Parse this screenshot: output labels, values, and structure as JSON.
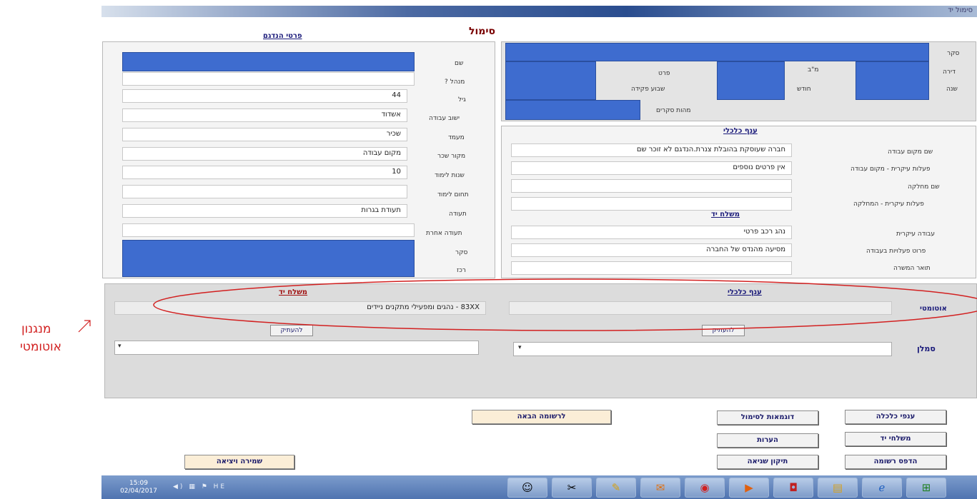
{
  "window": {
    "title": "סימול יד"
  },
  "page": {
    "title": "סימול"
  },
  "sample": {
    "header": "פרטי הנדגם",
    "labels": [
      "שם",
      "מנהל ?",
      "גיל",
      "ישוב עבודה",
      "מעמד",
      "מקור שכר",
      "שנות לימוד",
      "תחום לימוד",
      "תעודה",
      "תעודה אחרת",
      "סקר",
      "רכז"
    ],
    "name": "",
    "manager": "",
    "age": "44",
    "work_town": "אשדוד",
    "status": "שכיר",
    "salary_source": "מקום עבודה",
    "study_years": "10",
    "study_field": "",
    "certificate": "תעודת בגרות",
    "other_certificate": ""
  },
  "survey": {
    "labels": [
      "סקר",
      "דירה",
      "שנה"
    ],
    "cells": [
      "פרט",
      "מ\"ב",
      "שבוע פקידה",
      "חודש",
      "מהות סקרים"
    ]
  },
  "economic": {
    "header": "ענף כלכלי",
    "labels": [
      "שם מקום עבודה",
      "פעלות עיקרית - מקום עבודה",
      "שם מחלקה",
      "פעלות עיקרית - המחלקה"
    ],
    "workplace_name": "חברה שעוסקת בהובלת צנרת.הנדגם לא זוכר שם",
    "main_activity": "אין פרטים נוספים",
    "department": "",
    "department_activity": ""
  },
  "occupation": {
    "header": "משלח יד",
    "labels": [
      "עבודה עיקרית",
      "פרוט פעלויות בעבודה",
      "תואר המשרה"
    ],
    "main_job": "נהג רכב פרטי",
    "job_details": "מסיעה מהנדס של החברה",
    "job_title": ""
  },
  "auto": {
    "label": "אוטומטי",
    "economic_header": "ענף כלכלי",
    "occupation_header": "משלח יד",
    "economic_value": "",
    "occupation_value": "83XX - נהגים ומפעילי מתקנים ניידים",
    "copy_label": "להעתיק",
    "coder_label": "סמלן"
  },
  "annotation": {
    "line1": "מנגנון",
    "line2": "אוטומטי"
  },
  "buttons": {
    "economic_branches": "ענפי כלכלה",
    "examples": "דוגמאות לסימול",
    "next_record": "לרשומה הבאה",
    "occupations": "משלחי יד",
    "comments": "הערות",
    "print_record": "הדפס רשומה",
    "fix_error": "תיקון שגיאה",
    "save_exit": "שמירה ויציאה"
  },
  "taskbar": {
    "time": "15:09",
    "date": "02/04/2017",
    "lang": "HE",
    "icons": [
      "people-icon",
      "scissors-icon",
      "paint-icon",
      "outlook-icon",
      "chrome-icon",
      "media-icon",
      "oracle-icon",
      "folder-icon",
      "ie-icon",
      "start-icon"
    ]
  },
  "colors": {
    "accent_blue": "#3e6ccf",
    "annotation_red": "#d22020",
    "title_blue": "#1a1a7a"
  }
}
